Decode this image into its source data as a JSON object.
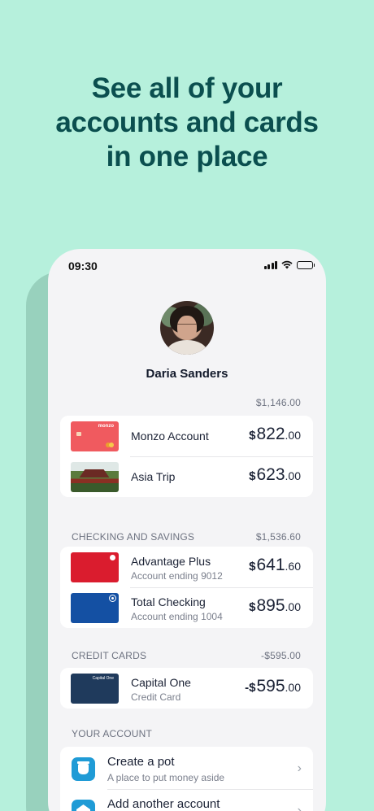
{
  "headline": [
    "See all of your",
    "accounts and cards",
    "in one place"
  ],
  "status_bar": {
    "time": "09:30"
  },
  "profile": {
    "name": "Daria Sanders"
  },
  "summary_total": "$1,146.00",
  "top_accounts": [
    {
      "label": "Monzo Account",
      "currency": "$",
      "amount_int": "822",
      "amount_dec": ".00",
      "card_brand": "monzo"
    },
    {
      "label": "Asia Trip",
      "currency": "$",
      "amount_int": "623",
      "amount_dec": ".00"
    }
  ],
  "checking_savings": {
    "title": "CHECKING AND SAVINGS",
    "total": "$1,536.60",
    "items": [
      {
        "label": "Advantage Plus",
        "sub": "Account ending 9012",
        "currency": "$",
        "amount_int": "641",
        "amount_dec": ".60"
      },
      {
        "label": "Total Checking",
        "sub": "Account ending 1004",
        "currency": "$",
        "amount_int": "895",
        "amount_dec": ".00"
      }
    ]
  },
  "credit_cards": {
    "title": "CREDIT CARDS",
    "total": "-$595.00",
    "items": [
      {
        "label": "Capital One",
        "sub": "Credit Card",
        "currency": "-$",
        "amount_int": "595",
        "amount_dec": ".00",
        "card_brand": "Capital One"
      }
    ]
  },
  "your_account": {
    "title": "YOUR ACCOUNT",
    "items": [
      {
        "label": "Create a pot",
        "sub": "A place to put money aside",
        "icon": "pot-icon"
      },
      {
        "label": "Add another account",
        "icon": "bank-icon"
      }
    ]
  },
  "colors": {
    "background": "#b6f0dc",
    "headline": "#0b4f4f",
    "monzo_card": "#f05a5f",
    "red_card": "#da1c2e",
    "blue_card": "#1450a3",
    "navy_card": "#1f3a5c",
    "action_icon": "#1f9bd6"
  }
}
